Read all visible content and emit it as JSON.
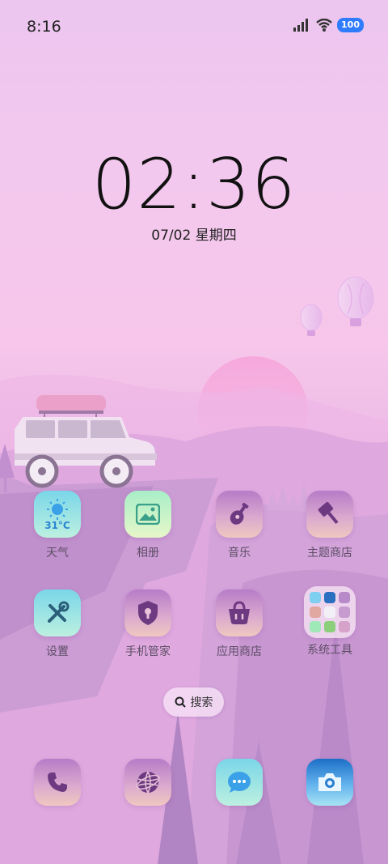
{
  "status_bar": {
    "time": "8:16",
    "battery": "100",
    "icons": [
      "signal-icon",
      "wifi-icon",
      "battery-icon"
    ]
  },
  "lockclock": {
    "time": "02:36",
    "date": "07/02 星期四"
  },
  "apps": [
    {
      "label": "天气",
      "icon": "weather-icon",
      "temp": "31°C"
    },
    {
      "label": "相册",
      "icon": "gallery-icon"
    },
    {
      "label": "音乐",
      "icon": "music-icon"
    },
    {
      "label": "主题商店",
      "icon": "theme-store-icon"
    },
    {
      "label": "设置",
      "icon": "settings-icon"
    },
    {
      "label": "手机管家",
      "icon": "phone-manager-icon"
    },
    {
      "label": "应用商店",
      "icon": "app-store-icon"
    },
    {
      "label": "系统工具",
      "icon": "system-tools-folder-icon"
    }
  ],
  "search": {
    "label": "搜索"
  },
  "dock": [
    {
      "icon": "phone-icon"
    },
    {
      "icon": "browser-icon"
    },
    {
      "icon": "messages-icon"
    },
    {
      "icon": "camera-icon"
    }
  ],
  "colors": {
    "accent_purple": "#b67cc7",
    "battery_blue": "#2f7cff",
    "text_dark": "#111111",
    "label_text": "#5e4e66"
  }
}
